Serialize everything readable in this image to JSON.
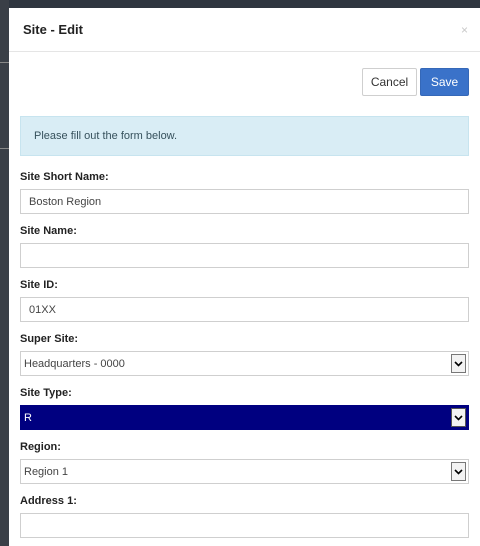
{
  "dialog": {
    "title": "Site - Edit",
    "close_label": "×"
  },
  "toolbar": {
    "cancel_label": "Cancel",
    "save_label": "Save"
  },
  "alert": {
    "message": "Please fill out the form below."
  },
  "form": {
    "site_short_name": {
      "label": "Site Short Name:",
      "value": "Boston Region"
    },
    "site_name": {
      "label": "Site Name:",
      "value": ""
    },
    "site_id": {
      "label": "Site ID:",
      "value": "01XX"
    },
    "super_site": {
      "label": "Super Site:",
      "value": "Headquarters - 0000"
    },
    "site_type": {
      "label": "Site Type:",
      "value": "R"
    },
    "region": {
      "label": "Region:",
      "value": "Region 1"
    },
    "address1": {
      "label": "Address 1:",
      "value": ""
    }
  },
  "colors": {
    "primary": "#3a72c9",
    "alert_bg": "#d9edf5",
    "selected_select_bg": "#000080"
  },
  "icons": {
    "close": "close-icon",
    "dropdown": "chevron-down-icon"
  }
}
